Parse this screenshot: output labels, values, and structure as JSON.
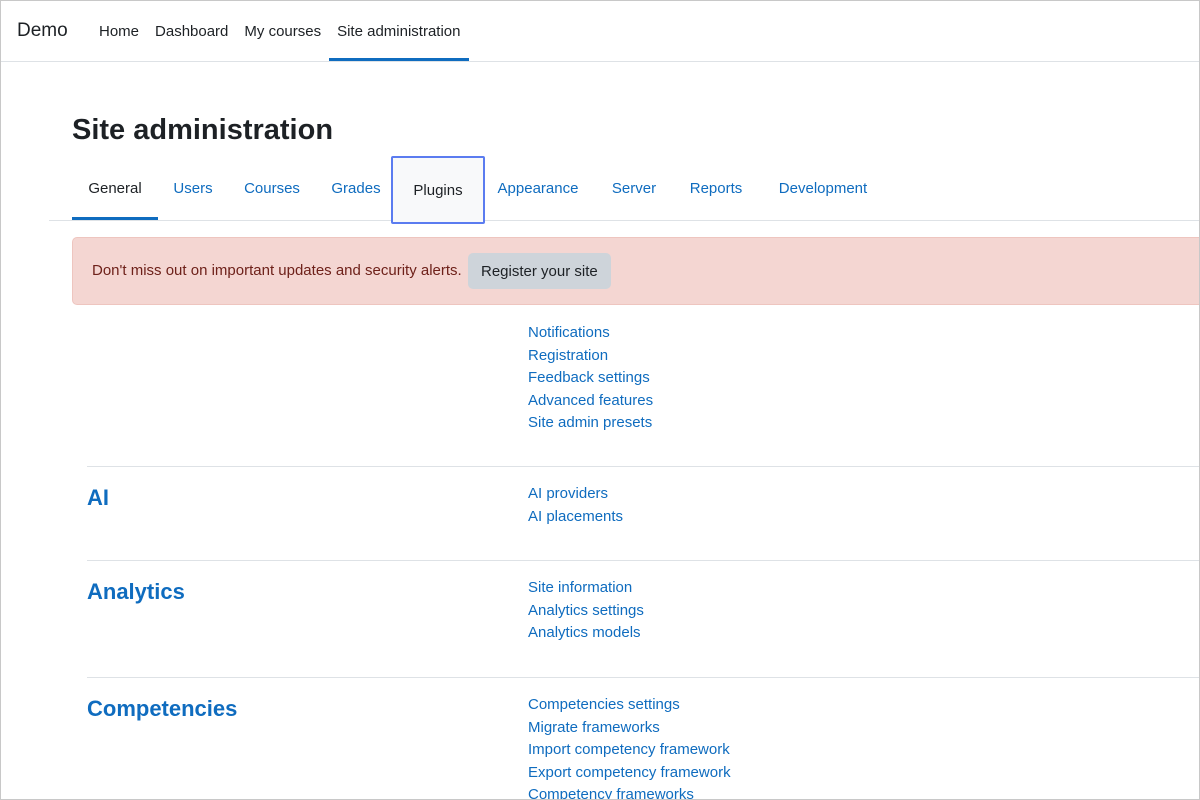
{
  "navbar": {
    "brand": "Demo",
    "items": [
      {
        "label": "Home"
      },
      {
        "label": "Dashboard"
      },
      {
        "label": "My courses"
      },
      {
        "label": "Site administration"
      }
    ]
  },
  "page": {
    "title": "Site administration"
  },
  "tabs": [
    {
      "label": "General"
    },
    {
      "label": "Users"
    },
    {
      "label": "Courses"
    },
    {
      "label": "Grades"
    },
    {
      "label": "Plugins"
    },
    {
      "label": "Appearance"
    },
    {
      "label": "Server"
    },
    {
      "label": "Reports"
    },
    {
      "label": "Development"
    }
  ],
  "alert": {
    "message": "Don't miss out on important updates and security alerts.",
    "button_label": "Register your site"
  },
  "sections": [
    {
      "heading": "",
      "links": [
        "Notifications",
        "Registration",
        "Feedback settings",
        "Advanced features",
        "Site admin presets"
      ]
    },
    {
      "heading": "AI",
      "links": [
        "AI providers",
        "AI placements"
      ]
    },
    {
      "heading": "Analytics",
      "links": [
        "Site information",
        "Analytics settings",
        "Analytics models"
      ]
    },
    {
      "heading": "Competencies",
      "links": [
        "Competencies settings",
        "Migrate frameworks",
        "Import competency framework",
        "Export competency framework",
        "Competency frameworks"
      ]
    }
  ],
  "colors": {
    "link": "#0f6cbf",
    "alert_background": "#f4d6d2",
    "alert_text": "#6e211a",
    "focus_ring": "#5b7cf0"
  }
}
